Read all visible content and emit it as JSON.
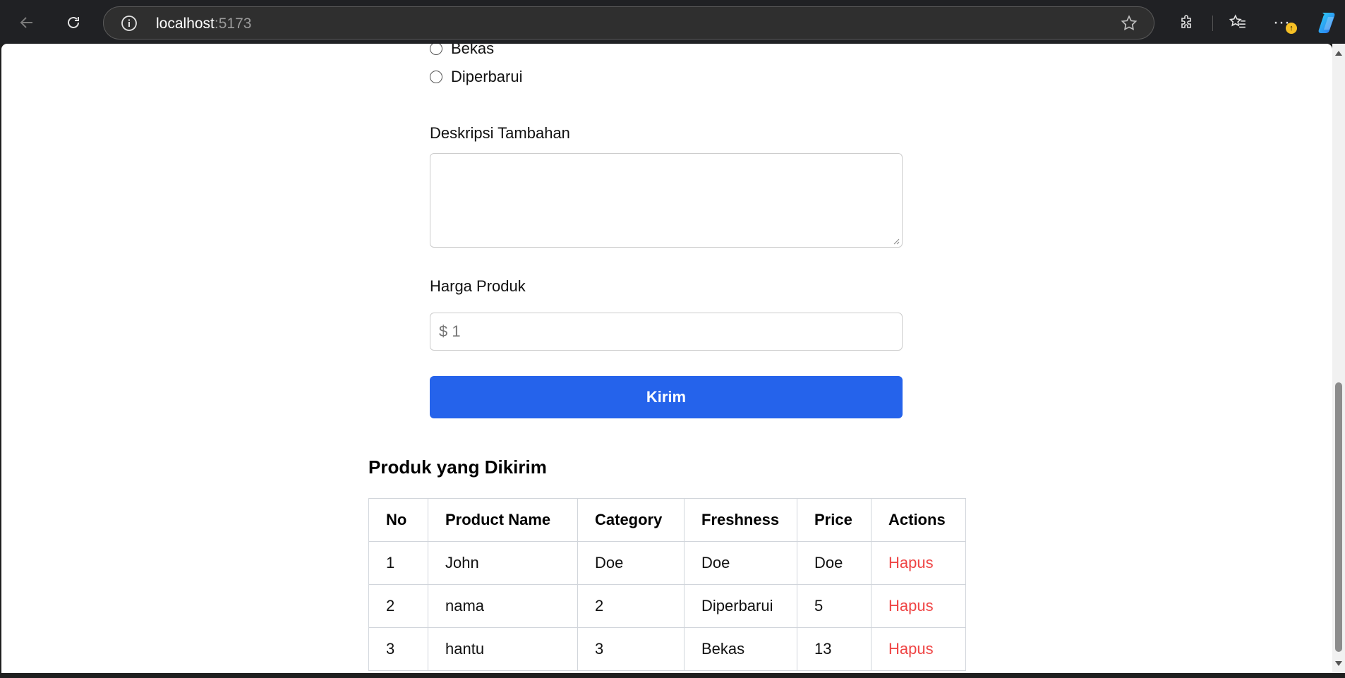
{
  "browser": {
    "url_host": "localhost",
    "url_port": ":5173",
    "more_label": "···",
    "update_badge": "↑"
  },
  "form": {
    "radio_options": [
      "Bekas",
      "Diperbarui"
    ],
    "description_label": "Deskripsi Tambahan",
    "description_value": "",
    "price_label": "Harga Produk",
    "price_placeholder": "$ 1",
    "submit_label": "Kirim"
  },
  "products": {
    "title": "Produk yang Dikirim",
    "columns": [
      "No",
      "Product Name",
      "Category",
      "Freshness",
      "Price",
      "Actions"
    ],
    "rows": [
      {
        "no": "1",
        "name": "John",
        "category": "Doe",
        "freshness": "Doe",
        "price": "Doe",
        "action": "Hapus"
      },
      {
        "no": "2",
        "name": "nama",
        "category": "2",
        "freshness": "Diperbarui",
        "price": "5",
        "action": "Hapus"
      },
      {
        "no": "3",
        "name": "hantu",
        "category": "3",
        "freshness": "Bekas",
        "price": "13",
        "action": "Hapus"
      }
    ]
  },
  "colors": {
    "accent": "#2563eb",
    "danger": "#ef4444"
  }
}
